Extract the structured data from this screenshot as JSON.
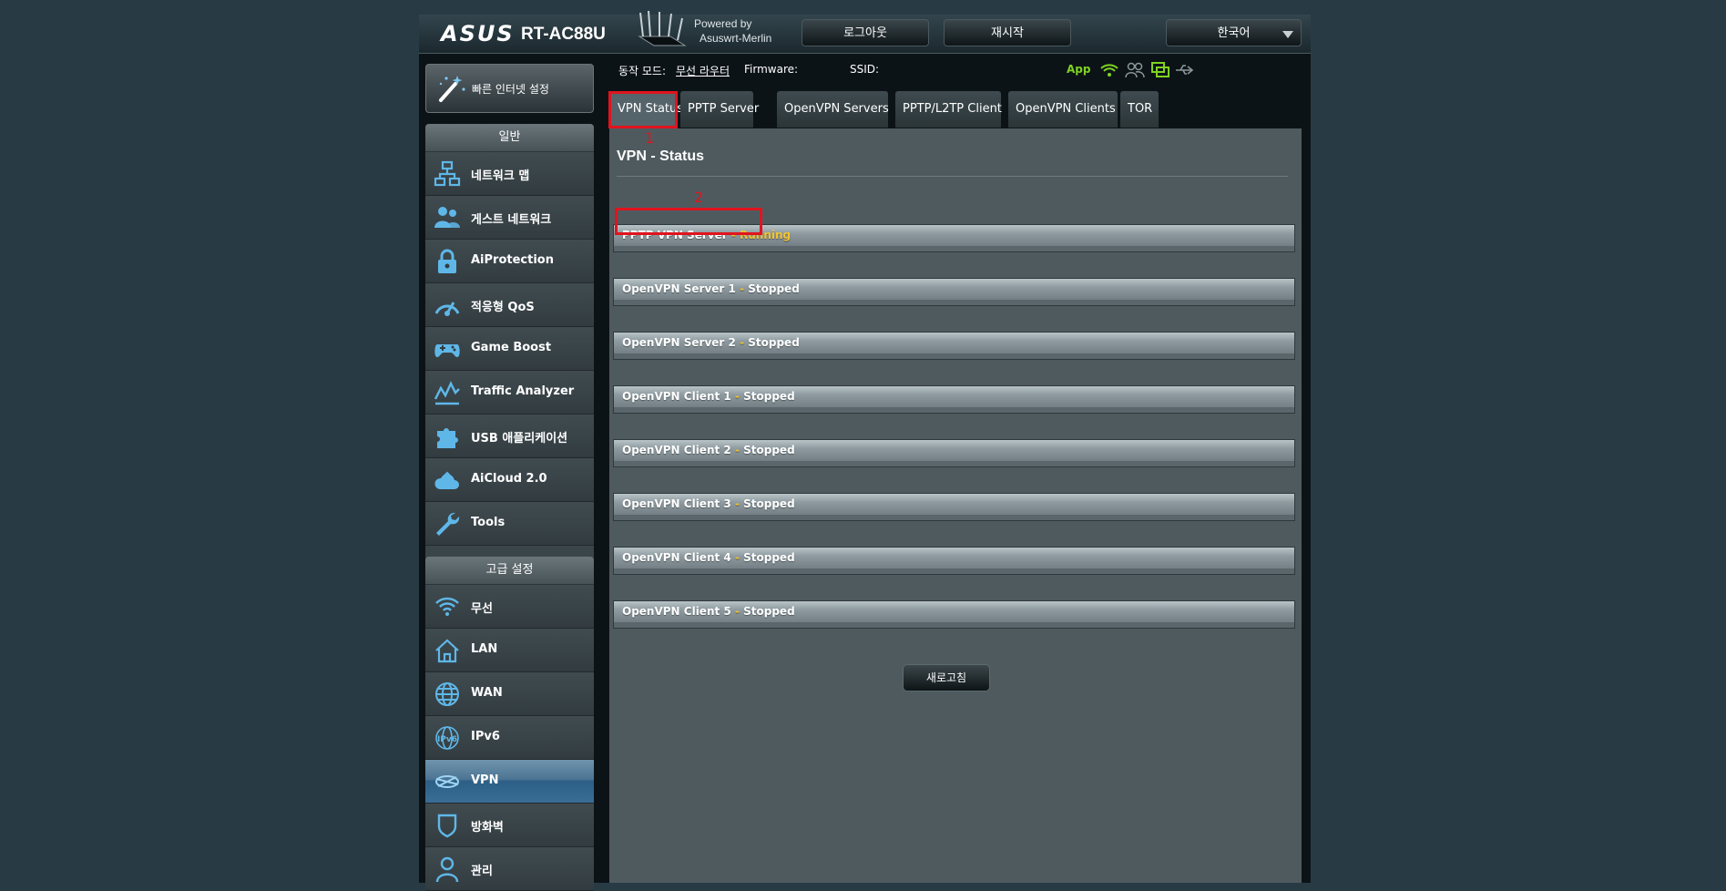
{
  "header": {
    "brand": "ASUS",
    "model": "RT-AC88U",
    "powered_by": "Powered by",
    "firmware_name": "Asuswrt-Merlin",
    "logout_label": "로그아웃",
    "reboot_label": "재시작",
    "language": "한국어"
  },
  "sidebar": {
    "quick_setup_label": "빠른 인터넷 설정",
    "general_heading": "일반",
    "general_items": [
      {
        "label": "네트워크 맵",
        "icon": "network-map-icon"
      },
      {
        "label": "게스트 네트워크",
        "icon": "guest-network-icon"
      },
      {
        "label": "AiProtection",
        "icon": "lock-icon"
      },
      {
        "label": "적응형 QoS",
        "icon": "gauge-icon"
      },
      {
        "label": "Game Boost",
        "icon": "gamepad-icon"
      },
      {
        "label": "Traffic Analyzer",
        "icon": "chart-icon"
      },
      {
        "label": "USB 애플리케이션",
        "icon": "puzzle-icon"
      },
      {
        "label": "AiCloud 2.0",
        "icon": "cloud-icon"
      },
      {
        "label": "Tools",
        "icon": "wrench-icon"
      }
    ],
    "advanced_heading": "고급 설정",
    "advanced_items": [
      {
        "label": "무선",
        "icon": "wifi-icon"
      },
      {
        "label": "LAN",
        "icon": "home-icon"
      },
      {
        "label": "WAN",
        "icon": "globe-icon"
      },
      {
        "label": "IPv6",
        "icon": "ipv6-icon"
      },
      {
        "label": "VPN",
        "icon": "vpn-icon",
        "active": true
      },
      {
        "label": "방화벽",
        "icon": "shield-icon"
      },
      {
        "label": "관리",
        "icon": "user-icon"
      }
    ]
  },
  "statusbar": {
    "mode_label": "동작 모드:",
    "mode_value": "무선 라우터",
    "firmware_label": "Firmware:",
    "ssid_label": "SSID:",
    "app_label": "App",
    "app_color": "#7ed321"
  },
  "tabs": [
    "VPN Status",
    "PPTP Server",
    "OpenVPN Servers",
    "PPTP/L2TP Client",
    "OpenVPN Clients",
    "TOR"
  ],
  "active_tab": "VPN Status",
  "annotations": [
    "1",
    "2"
  ],
  "content": {
    "title": "VPN - Status",
    "rows": [
      {
        "name": "PPTP VPN Server",
        "separator": "-",
        "status": "Running"
      },
      {
        "name": "OpenVPN Server 1",
        "separator": "-",
        "status": "Stopped"
      },
      {
        "name": "OpenVPN Server 2",
        "separator": "-",
        "status": "Stopped"
      },
      {
        "name": "OpenVPN Client 1",
        "separator": "-",
        "status": "Stopped"
      },
      {
        "name": "OpenVPN Client 2",
        "separator": "-",
        "status": "Stopped"
      },
      {
        "name": "OpenVPN Client 3",
        "separator": "-",
        "status": "Stopped"
      },
      {
        "name": "OpenVPN Client 4",
        "separator": "-",
        "status": "Stopped"
      },
      {
        "name": "OpenVPN Client 5",
        "separator": "-",
        "status": "Stopped"
      }
    ],
    "refresh_label": "새로고침"
  },
  "colors": {
    "highlight_red": "#e0141e",
    "running_yellow": "#f2c230",
    "active_menu_blue": "#2d5f86"
  }
}
